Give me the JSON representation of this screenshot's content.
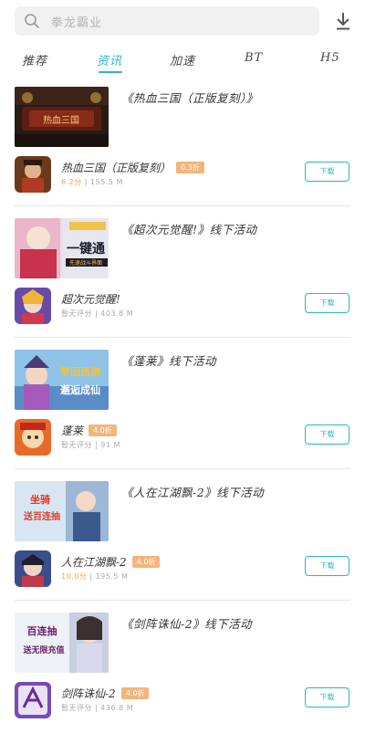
{
  "search": {
    "placeholder": "拳龙霸业"
  },
  "tabs": [
    {
      "label": "推荐"
    },
    {
      "label": "资讯"
    },
    {
      "label": "加速"
    },
    {
      "label": "BT"
    },
    {
      "label": "H5"
    }
  ],
  "articles": [
    {
      "title": "《热血三国（正版复刻）》",
      "app_name": "热血三国（正版复刻）",
      "badge": "0.3折",
      "score": "6.2分",
      "size": "155.5 M",
      "button": "下载",
      "banner_text": "热血三国",
      "icon_name": "game-icon-rexuesanguo"
    },
    {
      "title": "《超次元觉醒!》线下活动",
      "app_name": "超次元觉醒!",
      "badge": "",
      "score": "暂无评分",
      "size": "403.8 M",
      "button": "下载",
      "banner_text": "一键通",
      "banner_subtext": "先速战斗界面",
      "icon_name": "game-icon-chaociyuan"
    },
    {
      "title": "《蓬莱》线下活动",
      "app_name": "蓬莱",
      "badge": "4.0折",
      "score": "暂无评分",
      "size": "91 M",
      "button": "下载",
      "banner_text": "梦回西游",
      "banner_subtext": "邂逅成仙",
      "icon_name": "game-icon-penglai"
    },
    {
      "title": "《人在江湖飘-2》线下活动",
      "app_name": "人在江湖飘-2",
      "badge": "4.0折",
      "score": "10.0分",
      "size": "195.5 M",
      "button": "下载",
      "banner_text": "坐骑",
      "banner_subtext": "送百连抽",
      "icon_name": "game-icon-renzaijianghu"
    },
    {
      "title": "《剑阵诛仙-2》线下活动",
      "app_name": "剑阵诛仙-2",
      "badge": "4.0折",
      "score": "暂无评分",
      "size": "436.8 M",
      "button": "下载",
      "banner_text": "百连抽",
      "banner_subtext": "送无限充值",
      "icon_name": "game-icon-jianzhenzhuxian"
    }
  ],
  "colors": {
    "accent": "#29b7c7",
    "badge": "#f4b57a",
    "score": "#f2a04d"
  }
}
